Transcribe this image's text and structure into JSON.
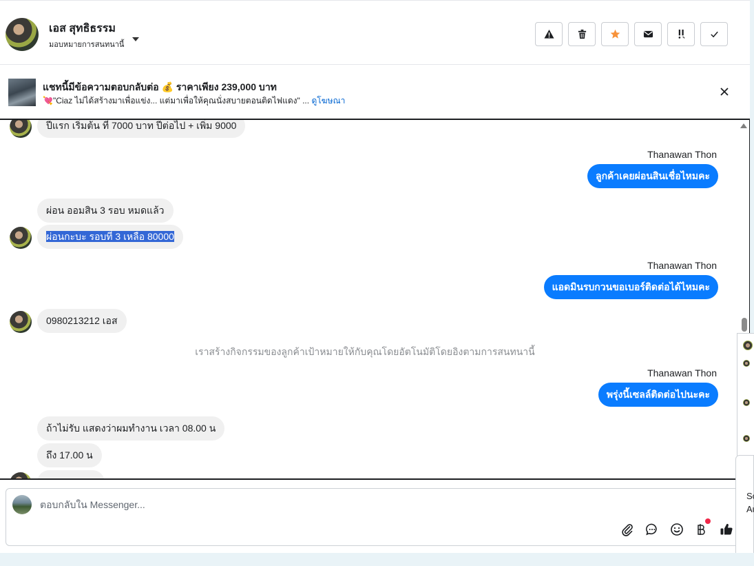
{
  "header": {
    "contact_name": "เอส สุทธิธรรม",
    "assign_label": "มอบหมายการสนทนานี้",
    "actions": [
      "spam-alert",
      "trash",
      "star",
      "mail",
      "follow-up",
      "done"
    ]
  },
  "ad": {
    "title": "แชทนี้มีข้อความตอบกลับต่อ 💰 ราคาเพียง 239,000 บาท",
    "subtitle": "💘\"Ciaz ไม่ได้สร้างมาเพื่อแข่ง... แต่มาเพื่อให้คุณนั่งสบายตอนติดไฟแดง\" ...",
    "link": "ดูโฆษณา"
  },
  "messages": {
    "m1": "ปีแรก เริ่มต้น ที่ 7000 บาท ปีต่อไป + เพิ่ม 9000",
    "sender1": "Thanawan Thon",
    "m2": "ลูกค้าเคยผ่อนสินเชื่อไหมคะ",
    "m3": "ผ่อน ออมสิน  3 รอบ หมดแล้ว",
    "m4": "ผ่อนกะบะ รอบที่ 3 เหลือ 80000",
    "sender2": "Thanawan Thon",
    "m5": "แอดมินรบกวนขอเบอร์ติดต่อได้ไหมคะ",
    "m6": "0980213212 เอส",
    "system": "เราสร้างกิจกรรมของลูกค้าเป้าหมายให้กับคุณโดยอัตโนมัติโดยอิงตามการสนทนานี้",
    "sender3": "Thanawan Thon",
    "m7": "พรุ่งนี้เซลล์ติดต่อไปนะคะ",
    "m8": "ถ้าไม่รับ แสดงว่าผมทำงาน เวลา 08.00 น",
    "m9": "ถึง 17.00 น"
  },
  "composer": {
    "placeholder": "ตอบกลับใน Messenger...",
    "tools": [
      "paperclip-icon",
      "chat-bubble-icon",
      "emoji-icon",
      "baht-icon",
      "thumbs-up-icon"
    ]
  },
  "side": {
    "text1": "So",
    "text2": "Au"
  },
  "colors": {
    "outgoing": "#0a7cff",
    "incoming": "#f0f0f0",
    "star": "#f7923a",
    "link": "#0064d1"
  }
}
